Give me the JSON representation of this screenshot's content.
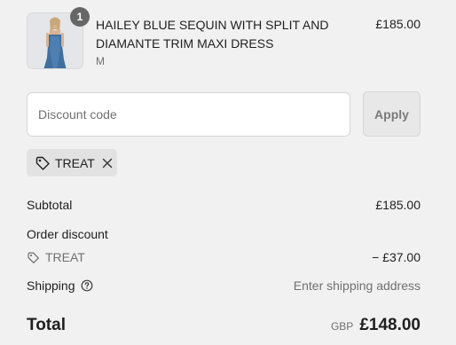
{
  "line_item": {
    "quantity": "1",
    "title": "HAILEY BLUE SEQUIN WITH SPLIT AND DIAMANTE TRIM MAXI DRESS",
    "variant": "M",
    "price": "£185.00",
    "thumbnail_icon": "product-photo"
  },
  "discount": {
    "placeholder": "Discount code",
    "apply_label": "Apply",
    "applied_code": "TREAT"
  },
  "summary": {
    "subtotal_label": "Subtotal",
    "subtotal_value": "£185.00",
    "order_discount_label": "Order discount",
    "discount_code": "TREAT",
    "discount_value": "− £37.00",
    "shipping_label": "Shipping",
    "shipping_value": "Enter shipping address",
    "total_label": "Total",
    "currency": "GBP",
    "total_value": "£148.00"
  },
  "colors": {
    "background": "#f1f1f1",
    "text": "#1f1f1f",
    "muted": "#707070",
    "chip": "#e2e2e2",
    "badge": "#666666",
    "dress_blue": "#3f6f9e"
  }
}
